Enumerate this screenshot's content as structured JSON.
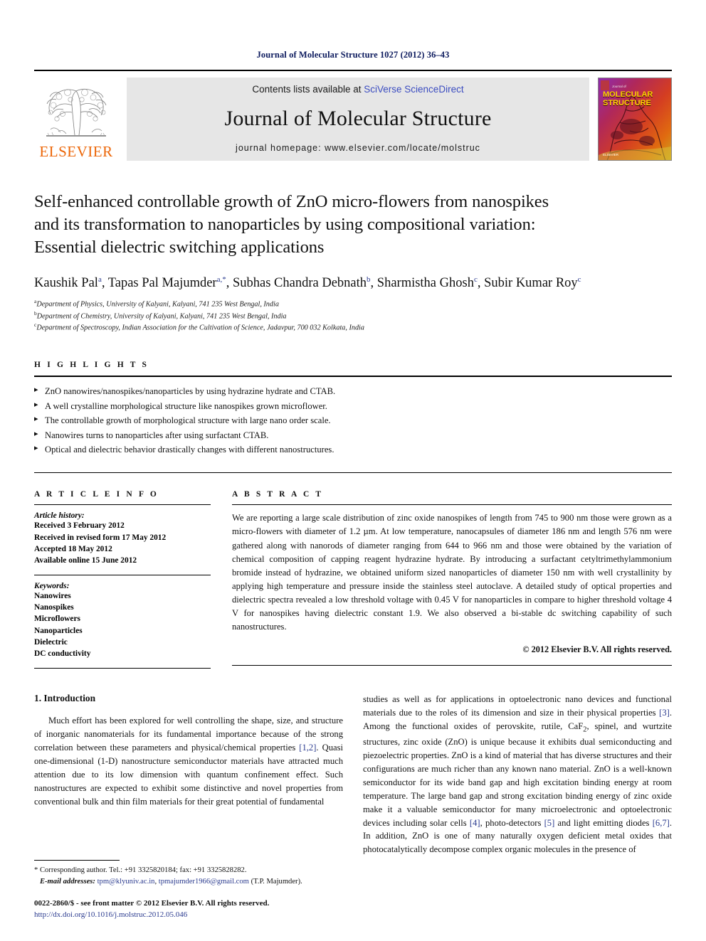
{
  "running_head": "Journal of Molecular Structure 1027 (2012) 36–43",
  "masthead": {
    "contents_prefix": "Contents lists available at ",
    "sciencedirect": "SciVerse ScienceDirect",
    "journal_name": "Journal of Molecular Structure",
    "homepage": "journal homepage: www.elsevier.com/locate/molstruc",
    "publisher_wordmark": "ELSEVIER",
    "cover_pretitle": "Journal of",
    "cover_title_line1": "MOLECULAR",
    "cover_title_line2": "STRUCTURE",
    "cover_footer": "ELSEVIER"
  },
  "article": {
    "title_line1": "Self-enhanced controllable growth of ZnO micro-flowers from nanospikes",
    "title_line2": "and its transformation to nanoparticles by using compositional variation:",
    "title_line3": "Essential dielectric switching applications",
    "authors": [
      {
        "name": "Kaushik Pal",
        "sup": "a"
      },
      {
        "name": "Tapas Pal Majumder",
        "sup": "a,*"
      },
      {
        "name": "Subhas Chandra Debnath",
        "sup": "b"
      },
      {
        "name": "Sharmistha Ghosh",
        "sup": "c"
      },
      {
        "name": "Subir Kumar Roy",
        "sup": "c"
      }
    ],
    "affiliations": [
      {
        "marker": "a",
        "text": "Department of Physics, University of Kalyani, Kalyani, 741 235 West Bengal, India"
      },
      {
        "marker": "b",
        "text": "Department of Chemistry, University of Kalyani, Kalyani, 741 235 West Bengal, India"
      },
      {
        "marker": "c",
        "text": "Department of Spectroscopy, Indian Association for the Cultivation of Science, Jadavpur, 700 032 Kolkata, India"
      }
    ]
  },
  "highlights": {
    "label": "H I G H L I G H T S",
    "items": [
      "ZnO nanowires/nanospikes/nanoparticles by using hydrazine hydrate and CTAB.",
      "A well crystalline morphological structure like nanospikes grown microflower.",
      "The controllable growth of morphological structure with large nano order scale.",
      "Nanowires turns to nanoparticles after using surfactant CTAB.",
      "Optical and dielectric behavior drastically changes with different nanostructures."
    ]
  },
  "article_info": {
    "label": "A R T I C L E    I N F O",
    "history_label": "Article history:",
    "history": [
      "Received 3 February 2012",
      "Received in revised form 17 May 2012",
      "Accepted 18 May 2012",
      "Available online 15 June 2012"
    ],
    "keywords_label": "Keywords:",
    "keywords": [
      "Nanowires",
      "Nanospikes",
      "Microflowers",
      "Nanoparticles",
      "Dielectric",
      "DC conductivity"
    ]
  },
  "abstract": {
    "label": "A B S T R A C T",
    "text": "We are reporting a large scale distribution of zinc oxide nanospikes of length from 745 to 900 nm those were grown as a micro-flowers with diameter of 1.2 µm. At low temperature, nanocapsules of diameter 186 nm and length 576 nm were gathered along with nanorods of diameter ranging from 644 to 966 nm and those were obtained by the variation of chemical composition of capping reagent hydrazine hydrate. By introducing a surfactant cetyltrimethylammonium bromide instead of hydrazine, we obtained uniform sized nanoparticles of diameter 150 nm with well crystallinity by applying high temperature and pressure inside the stainless steel autoclave. A detailed study of optical properties and dielectric spectra revealed a low threshold voltage with 0.45 V for nanoparticles in compare to higher threshold voltage 4 V for nanospikes having dielectric constant 1.9. We also observed a bi-stable dc switching capability of such nanostructures.",
    "copyright": "© 2012 Elsevier B.V. All rights reserved."
  },
  "body": {
    "section_title": "1. Introduction",
    "left_paragraph_a": "Much effort has been explored for well controlling the shape, size, and structure of inorganic nanomaterials for its fundamental importance because of the strong correlation between these parameters and physical/chemical properties ",
    "left_ref_1": "[1,2]",
    "left_paragraph_b": ". Quasi one-dimensional (1-D) nanostructure semiconductor materials have attracted much attention due to its low dimension with quantum confinement effect. Such nanostructures are expected to exhibit some distinctive and novel properties from conventional bulk and thin film materials for their great potential of fundamental",
    "right_paragraph_a": "studies as well as for applications in optoelectronic nano devices and functional materials due to the roles of its dimension and size in their physical properties ",
    "right_ref_3": "[3]",
    "right_paragraph_b": ". Among the functional oxides of perovskite, rutile, CaF",
    "right_sub_2": "2",
    "right_paragraph_c": ", spinel, and wurtzite structures, zinc oxide (ZnO) is unique because it exhibits dual semiconducting and piezoelectric properties. ZnO is a kind of material that has diverse structures and their configurations are much richer than any known nano material. ZnO is a well-known semiconductor for its wide band gap and high excitation binding energy at room temperature. The large band gap and strong excitation binding energy of zinc oxide make it a valuable semiconductor for many microelectronic and optoelectronic devices including solar cells ",
    "right_ref_4": "[4]",
    "right_paragraph_d": ", photo-detectors ",
    "right_ref_5": "[5]",
    "right_paragraph_e": " and light emitting diodes ",
    "right_ref_67": "[6,7]",
    "right_paragraph_f": ". In addition, ZnO is one of many naturally oxygen deficient metal oxides that photocatalytically decompose complex organic molecules in the presence of"
  },
  "footnotes": {
    "corresponding": "* Corresponding author. Tel.: +91 3325820184; fax: +91 3325828282.",
    "email_label": "E-mail addresses:",
    "email_1": "tpm@klyuniv.ac.in",
    "email_2": "tpmajumder1966@gmail.com",
    "email_attrib": "(T.P. Majumder).",
    "issn": "0022-2860/$ - see front matter © 2012 Elsevier B.V. All rights reserved.",
    "doi": "http://dx.doi.org/10.1016/j.molstruc.2012.05.046"
  },
  "colors": {
    "elsevier_orange": "#ec6608",
    "link_blue": "#2b3b8f",
    "sciencedirect_blue": "#3b4cc0",
    "masthead_gray": "#e6e6e6",
    "running_head_navy": "#0d1b5e"
  }
}
